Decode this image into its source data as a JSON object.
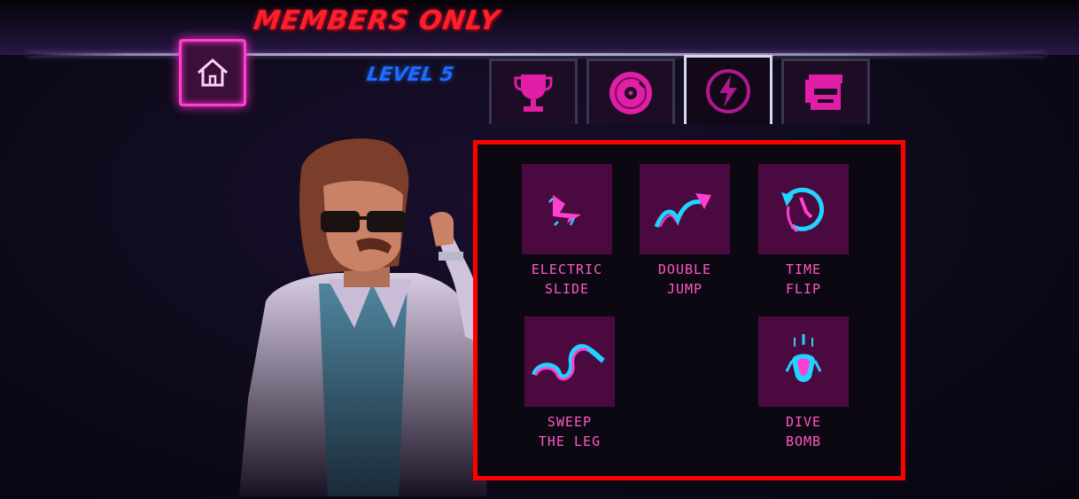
{
  "header": {
    "title": "MEMBERS ONLY",
    "level": "LEVEL 5"
  },
  "nav": {
    "home_icon": "home-icon",
    "tabs": [
      {
        "icon": "trophy-icon",
        "active": false
      },
      {
        "icon": "record-icon",
        "active": false
      },
      {
        "icon": "lightning-icon",
        "active": true
      },
      {
        "icon": "character-face-icon",
        "active": false
      }
    ]
  },
  "skills": [
    {
      "label": "ELECTRIC\nSLIDE",
      "icon": "electric-slide-icon"
    },
    {
      "label": "DOUBLE\nJUMP",
      "icon": "double-jump-icon"
    },
    {
      "label": "TIME\nFLIP",
      "icon": "time-flip-icon"
    },
    {
      "label": "SWEEP\nTHE LEG",
      "icon": "sweep-the-leg-icon"
    },
    {
      "label": "DIVE\nBOMB",
      "icon": "dive-bomb-icon"
    }
  ],
  "colors": {
    "accent_pink": "#ff3fd0",
    "title_red": "#ff1f2a",
    "level_blue": "#1e6bff",
    "icon_cyan": "#22d3ff",
    "tile_bg": "#4a0a40",
    "highlight_border": "#ff0000"
  }
}
